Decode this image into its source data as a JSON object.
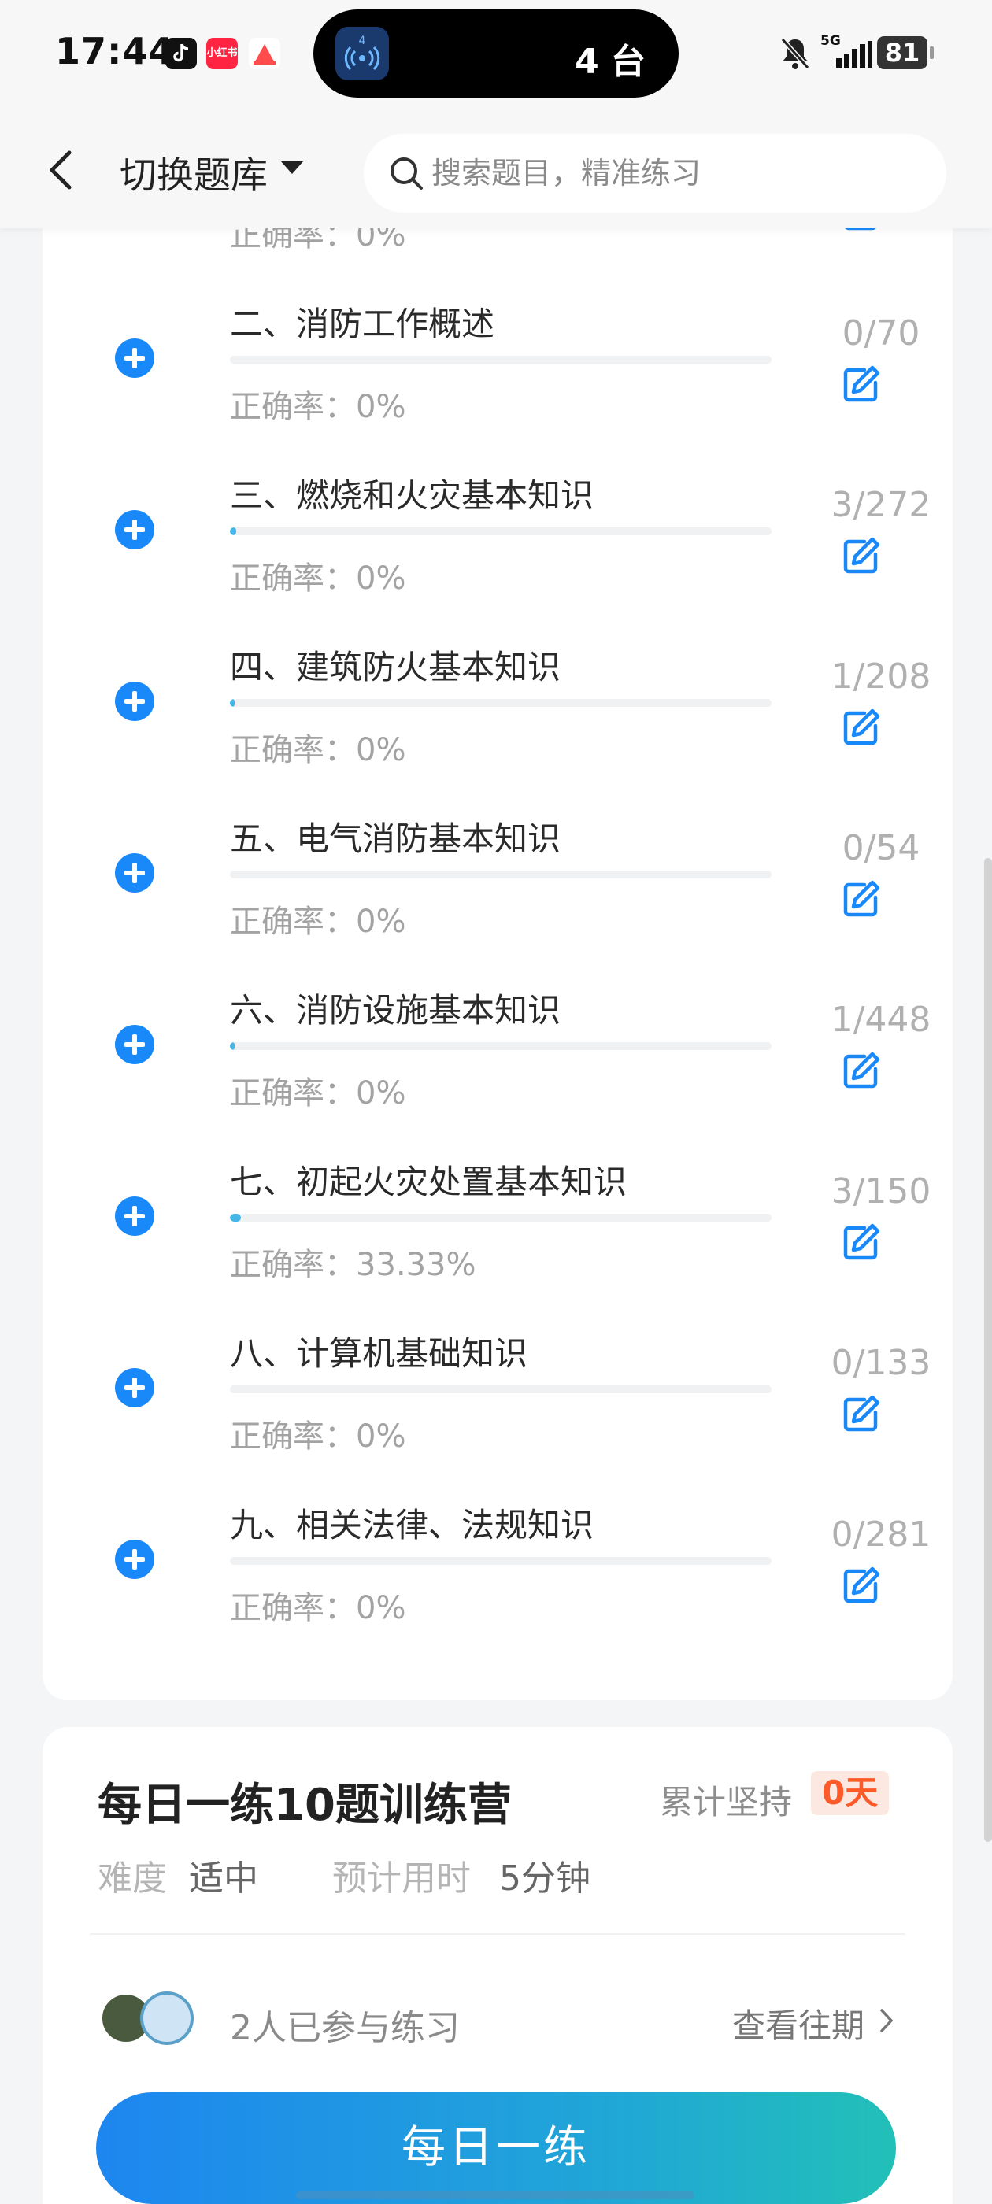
{
  "status_bar": {
    "time": "17:44",
    "island_text": "4 台",
    "network": "5G",
    "battery": "81",
    "icons": [
      "tiktok-icon",
      "xiaohongshu-icon",
      "app-icon",
      "mute-icon",
      "signal-icon",
      "battery-icon"
    ]
  },
  "header": {
    "title": "切换题库",
    "search_placeholder": "搜索题目，精准练习"
  },
  "chapters": [
    {
      "name": "",
      "accuracy": "正确率：0%",
      "count": "",
      "progress": 0
    },
    {
      "name": "二、消防工作概述",
      "accuracy": "正确率：0%",
      "count": "0/70",
      "progress": 0
    },
    {
      "name": "三、燃烧和火灾基本知识",
      "accuracy": "正确率：0%",
      "count": "3/272",
      "progress": 0.011
    },
    {
      "name": "四、建筑防火基本知识",
      "accuracy": "正确率：0%",
      "count": "1/208",
      "progress": 0.005
    },
    {
      "name": "五、电气消防基本知识",
      "accuracy": "正确率：0%",
      "count": "0/54",
      "progress": 0
    },
    {
      "name": "六、消防设施基本知识",
      "accuracy": "正确率：0%",
      "count": "1/448",
      "progress": 0.002
    },
    {
      "name": "七、初起火灾处置基本知识",
      "accuracy": "正确率：33.33%",
      "count": "3/150",
      "progress": 0.02
    },
    {
      "name": "八、计算机基础知识",
      "accuracy": "正确率：0%",
      "count": "0/133",
      "progress": 0
    },
    {
      "name": "九、相关法律、法规知识",
      "accuracy": "正确率：0%",
      "count": "0/281",
      "progress": 0
    }
  ],
  "daily": {
    "title": "每日一练10题训练营",
    "persist_label": "累计坚持",
    "days": "0天",
    "difficulty_label": "难度",
    "difficulty_value": "适中",
    "time_label": "预计用时",
    "time_value": "5分钟",
    "participants": "2人已参与练习",
    "history_link": "查看往期",
    "cta": "每日一练"
  },
  "colors": {
    "accent": "#1989fa",
    "progress": "#45b6e8",
    "badge_text": "#fd5a2a",
    "badge_bg": "#fde8e1"
  }
}
